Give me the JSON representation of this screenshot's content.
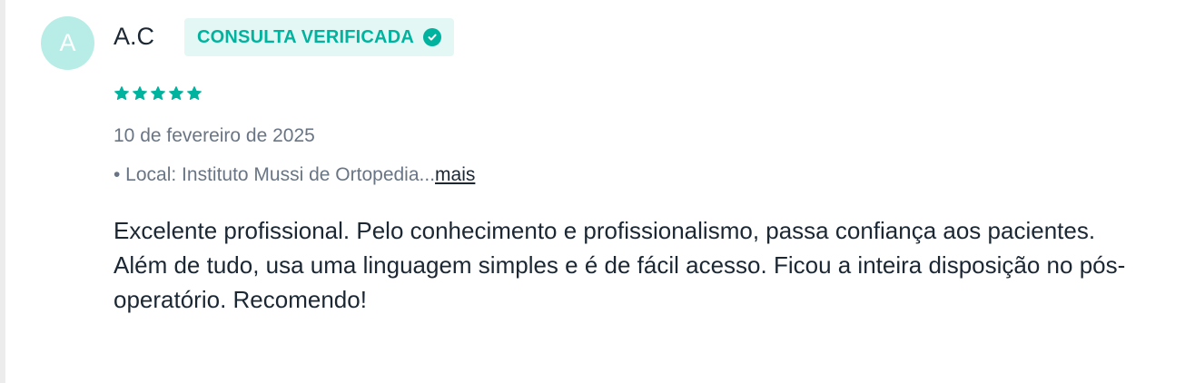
{
  "review": {
    "avatar_initial": "A",
    "author": "A.C",
    "badge_label": "CONSULTA VERIFICADA",
    "rating": 5,
    "rating_max": 5,
    "date": "10 de fevereiro de 2025",
    "location_prefix": "• Local: Instituto Mussi de Ortopedia...",
    "more_link": "mais",
    "text": "Excelente profissional. Pelo conhecimento e profissionalismo, passa confiança aos pacientes. Além de tudo, usa uma linguagem simples e é de fácil acesso. Ficou a inteira disposição no pós-operatório. Recomendo!"
  },
  "colors": {
    "accent": "#00b39e",
    "badge_bg": "#e3f7f4",
    "avatar_bg": "#b8ece6",
    "text_primary": "#1b2733",
    "text_secondary": "#697584"
  },
  "icons": {
    "badge": "check-circle-icon",
    "rating": "star-icon"
  }
}
